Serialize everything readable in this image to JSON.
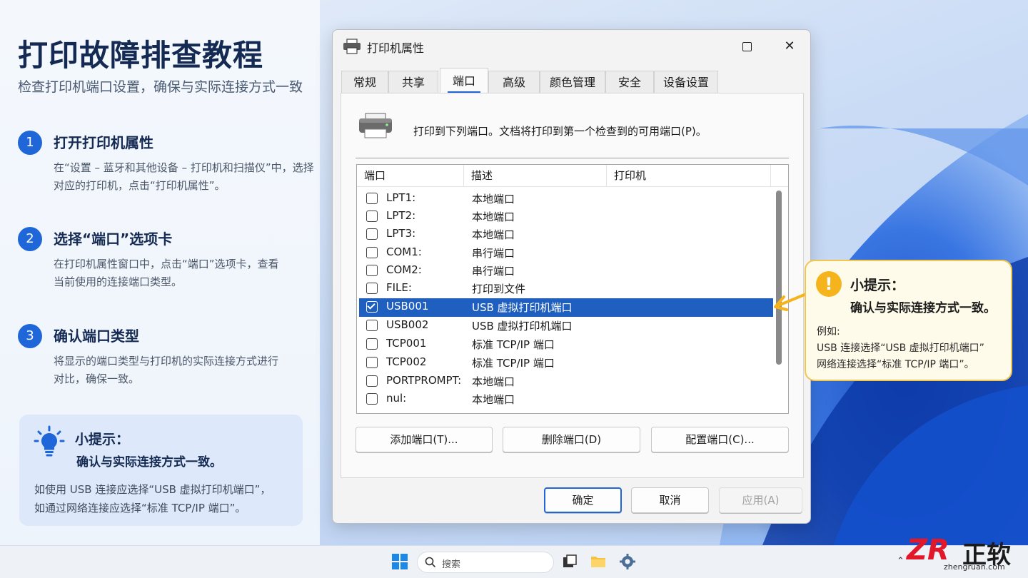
{
  "tutorial": {
    "title": "打印故障排查教程",
    "subtitle": "检查打印机端口设置，确保与实际连接方式一致",
    "steps": [
      {
        "num": "1",
        "title": "打开打印机属性",
        "desc": "在“设置 – 蓝牙和其他设备 – 打印机和扫描仪”中，选择对应的打印机，点击“打印机属性”。"
      },
      {
        "num": "2",
        "title": "选择“端口”选项卡",
        "desc": "在打印机属性窗口中，点击“端口”选项卡，查看当前使用的连接端口类型。"
      },
      {
        "num": "3",
        "title": "确认端口类型",
        "desc": "将显示的端口类型与打印机的实际连接方式进行对比，确保一致。"
      }
    ],
    "tip": {
      "title": "小提示：",
      "sub": "确认与实际连接方式一致。",
      "line1": "如使用 USB 连接应选择“USB 虚拟打印机端口”，",
      "line2": "如通过网络连接应选择“标准 TCP/IP 端口”。"
    }
  },
  "dialog": {
    "title": "打印机属性",
    "tabs": [
      "常规",
      "共享",
      "端口",
      "高级",
      "颜色管理",
      "安全",
      "设备设置"
    ],
    "active_tab": "端口",
    "intro": "打印到下列端口。文档将打印到第一个检查到的可用端口(P)。",
    "columns": [
      "端口",
      "描述",
      "打印机"
    ],
    "ports": [
      {
        "port": "LPT1:",
        "desc": "本地端口",
        "checked": false
      },
      {
        "port": "LPT2:",
        "desc": "本地端口",
        "checked": false
      },
      {
        "port": "LPT3:",
        "desc": "本地端口",
        "checked": false
      },
      {
        "port": "COM1:",
        "desc": "串行端口",
        "checked": false
      },
      {
        "port": "COM2:",
        "desc": "串行端口",
        "checked": false
      },
      {
        "port": "FILE:",
        "desc": "打印到文件",
        "checked": false
      },
      {
        "port": "USB001",
        "desc": "USB 虚拟打印机端口",
        "checked": true
      },
      {
        "port": "USB002",
        "desc": "USB 虚拟打印机端口",
        "checked": false
      },
      {
        "port": "TCP001",
        "desc": "标准 TCP/IP 端口",
        "checked": false
      },
      {
        "port": "TCP002",
        "desc": "标准 TCP/IP 端口",
        "checked": false
      },
      {
        "port": "PORTPROMPT:",
        "desc": "本地端口",
        "checked": false
      },
      {
        "port": "nul:",
        "desc": "本地端口",
        "checked": false
      }
    ],
    "buttons": {
      "add": "添加端口(T)...",
      "delete": "删除端口(D)",
      "configure": "配置端口(C)...",
      "ok": "确定",
      "cancel": "取消",
      "apply": "应用(A)"
    }
  },
  "callout": {
    "title": "小提示：",
    "sub": "确认与实际连接方式一致。",
    "line1": "例如:",
    "line2": "USB 连接选择“USB 虚拟打印机端口”",
    "line3": "网络连接选择“标准 TCP/IP 端口”。"
  },
  "taskbar": {
    "search_placeholder": "搜索"
  },
  "brand": {
    "mark": "ZR",
    "name": "正软",
    "url": "zhengruan.com"
  },
  "colors": {
    "accent": "#1f66d8",
    "selection": "#1f5fbf",
    "callout_border": "#f3c64f",
    "warning": "#f5b41c"
  }
}
